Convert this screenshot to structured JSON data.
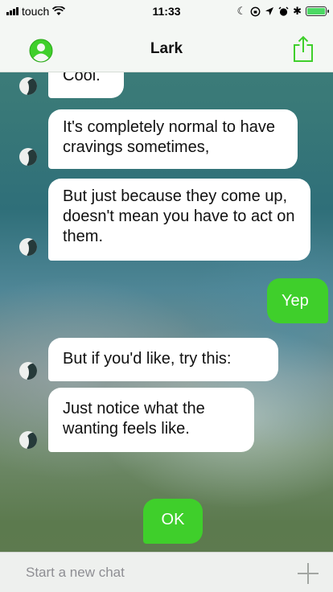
{
  "status_bar": {
    "carrier": "touch",
    "time": "11:33",
    "battery_level": 1.0
  },
  "nav": {
    "title": "Lark",
    "left_icon": "profile-icon",
    "right_icon": "share-icon"
  },
  "messages": [
    {
      "from": "bot",
      "text": "Cool."
    },
    {
      "from": "bot",
      "text": "It's completely normal to have cravings sometimes,"
    },
    {
      "from": "bot",
      "text": "But just because they come up, doesn't mean you have to act on them."
    },
    {
      "from": "user",
      "text": "Yep"
    },
    {
      "from": "bot",
      "text": "But if you'd like, try this:"
    },
    {
      "from": "bot",
      "text": "Just notice what the wanting feels like."
    },
    {
      "from": "user",
      "text": "OK"
    }
  ],
  "input": {
    "placeholder": "Start a new chat"
  },
  "colors": {
    "user_bubble": "#3fcf2b",
    "bot_bubble": "#ffffff",
    "bar_background": "#f4f7f4"
  }
}
